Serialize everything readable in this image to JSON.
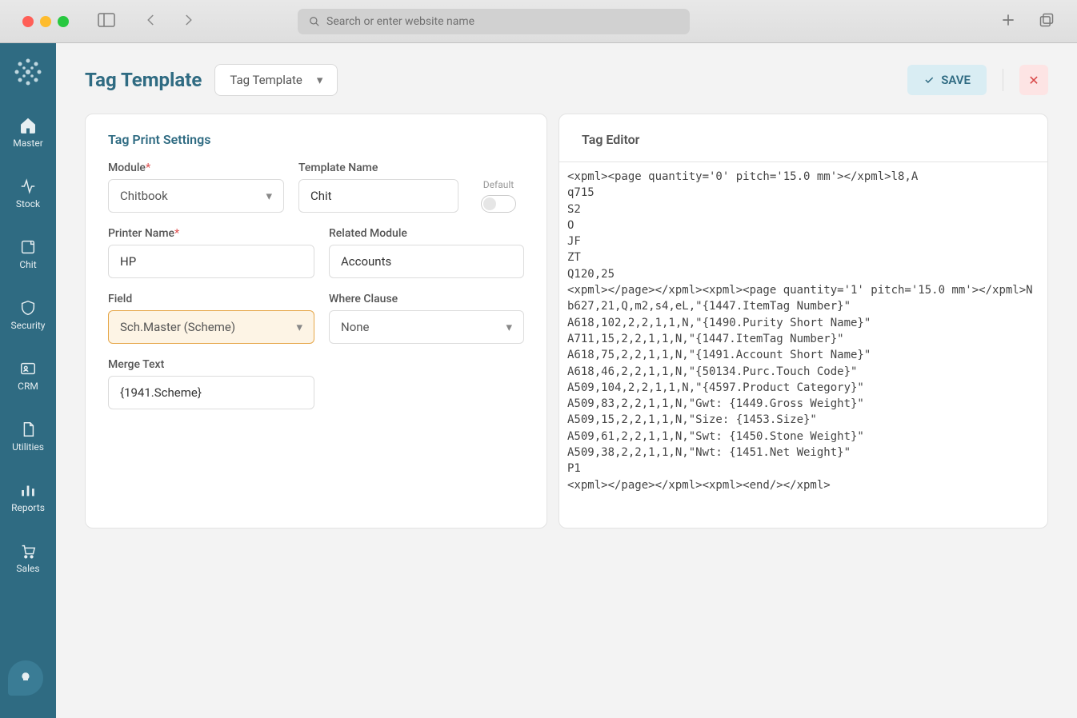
{
  "browser": {
    "search_placeholder": "Search or enter website name"
  },
  "sidebar": {
    "items": [
      {
        "label": "Master"
      },
      {
        "label": "Stock"
      },
      {
        "label": "Chit"
      },
      {
        "label": "Security"
      },
      {
        "label": "CRM"
      },
      {
        "label": "Utilities"
      },
      {
        "label": "Reports"
      },
      {
        "label": "Sales"
      }
    ]
  },
  "header": {
    "title": "Tag Template",
    "dropdown_value": "Tag Template",
    "save_label": "SAVE"
  },
  "panel_left": {
    "title": "Tag Print Settings",
    "module_label": "Module",
    "module_value": "Chitbook",
    "template_name_label": "Template Name",
    "template_name_value": "Chit",
    "default_label": "Default",
    "printer_label": "Printer Name",
    "printer_value": "HP",
    "related_module_label": "Related Module",
    "related_module_value": "Accounts",
    "field_label": "Field",
    "field_value": "Sch.Master (Scheme)",
    "where_label": "Where Clause",
    "where_value": "None",
    "merge_label": "Merge Text",
    "merge_value": "{1941.Scheme}"
  },
  "panel_right": {
    "title": "Tag Editor",
    "content": "<xpml><page quantity='0' pitch='15.0 mm'></xpml>l8,A\nq715\nS2\nO\nJF\nZT\nQ120,25\n<xpml></page></xpml><xpml><page quantity='1' pitch='15.0 mm'></xpml>N\nb627,21,Q,m2,s4,eL,\"{1447.ItemTag Number}\"\nA618,102,2,2,1,1,N,\"{1490.Purity Short Name}\"\nA711,15,2,2,1,1,N,\"{1447.ItemTag Number}\"\nA618,75,2,2,1,1,N,\"{1491.Account Short Name}\"\nA618,46,2,2,1,1,N,\"{50134.Purc.Touch Code}\"\nA509,104,2,2,1,1,N,\"{4597.Product Category}\"\nA509,83,2,2,1,1,N,\"Gwt: {1449.Gross Weight}\"\nA509,15,2,2,1,1,N,\"Size: {1453.Size}\"\nA509,61,2,2,1,1,N,\"Swt: {1450.Stone Weight}\"\nA509,38,2,2,1,1,N,\"Nwt: {1451.Net Weight}\"\nP1\n<xpml></page></xpml><xpml><end/></xpml>"
  }
}
